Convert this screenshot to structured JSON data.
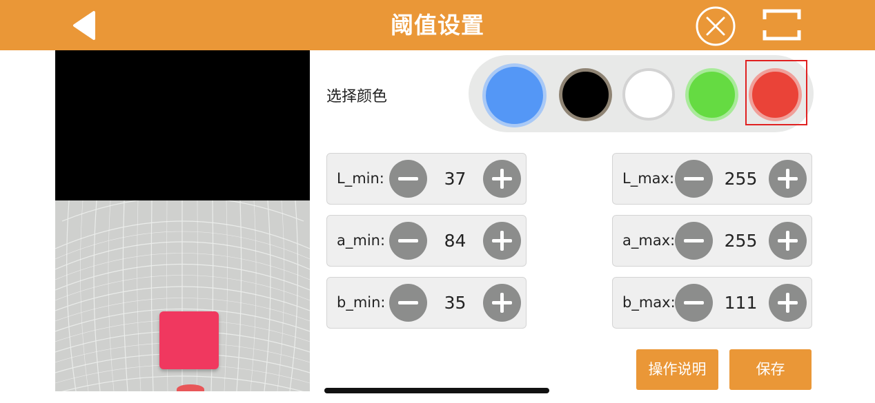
{
  "header": {
    "title": "阈值设置",
    "accent_color": "#ea9737",
    "back_icon": "back-arrow-icon",
    "close_icon": "close-circle-icon",
    "fullscreen_icon": "fullscreen-icon"
  },
  "color_picker": {
    "label": "选择颜色",
    "swatches": [
      {
        "name": "blue",
        "color": "#5497f6"
      },
      {
        "name": "black",
        "color": "#000000"
      },
      {
        "name": "white",
        "color": "#ffffff"
      },
      {
        "name": "green",
        "color": "#65db42"
      },
      {
        "name": "red",
        "color": "#ea4338"
      }
    ],
    "selected": "red"
  },
  "thresholds": {
    "l_min": {
      "label": "L_min:",
      "value": "37"
    },
    "l_max": {
      "label": "L_max:",
      "value": "255"
    },
    "a_min": {
      "label": "a_min:",
      "value": "84"
    },
    "a_max": {
      "label": "a_max:",
      "value": "255"
    },
    "b_min": {
      "label": "b_min:",
      "value": "35"
    },
    "b_max": {
      "label": "b_max:",
      "value": "111"
    }
  },
  "actions": {
    "help_label": "操作说明",
    "save_label": "保存"
  }
}
